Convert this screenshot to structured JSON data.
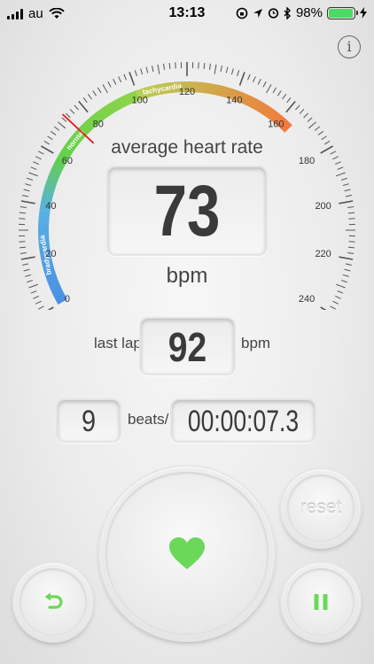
{
  "status_bar": {
    "carrier": "au",
    "time": "13:13",
    "battery": "98%",
    "battery_level": 0.98
  },
  "info_button": {
    "label": "i"
  },
  "gauge": {
    "min": 0,
    "max": 240,
    "tick_labels": [
      "0",
      "20",
      "40",
      "60",
      "80",
      "100",
      "120",
      "140",
      "160",
      "180",
      "200",
      "220",
      "240"
    ],
    "zone_labels": [
      "bradycardia",
      "normal",
      "tachycardia"
    ],
    "colors": {
      "bradycardia": "#4a90e2",
      "normal": "#63d14a",
      "tachycardia": "#f2793d",
      "needle": "#e02020"
    },
    "needle_value": 73
  },
  "average": {
    "label": "average heart rate",
    "value": "73",
    "unit": "bpm"
  },
  "last_lap": {
    "label": "last lap",
    "value": "92",
    "unit": "bpm"
  },
  "beats": {
    "count": "9",
    "label": "beats/"
  },
  "timer": {
    "value": "00:00:07.3"
  },
  "buttons": {
    "reset": "reset",
    "heart_icon": "heart-icon",
    "back_icon": "undo-arrow-icon",
    "pause_icon": "pause-icon",
    "accent": "#6cd85a"
  }
}
